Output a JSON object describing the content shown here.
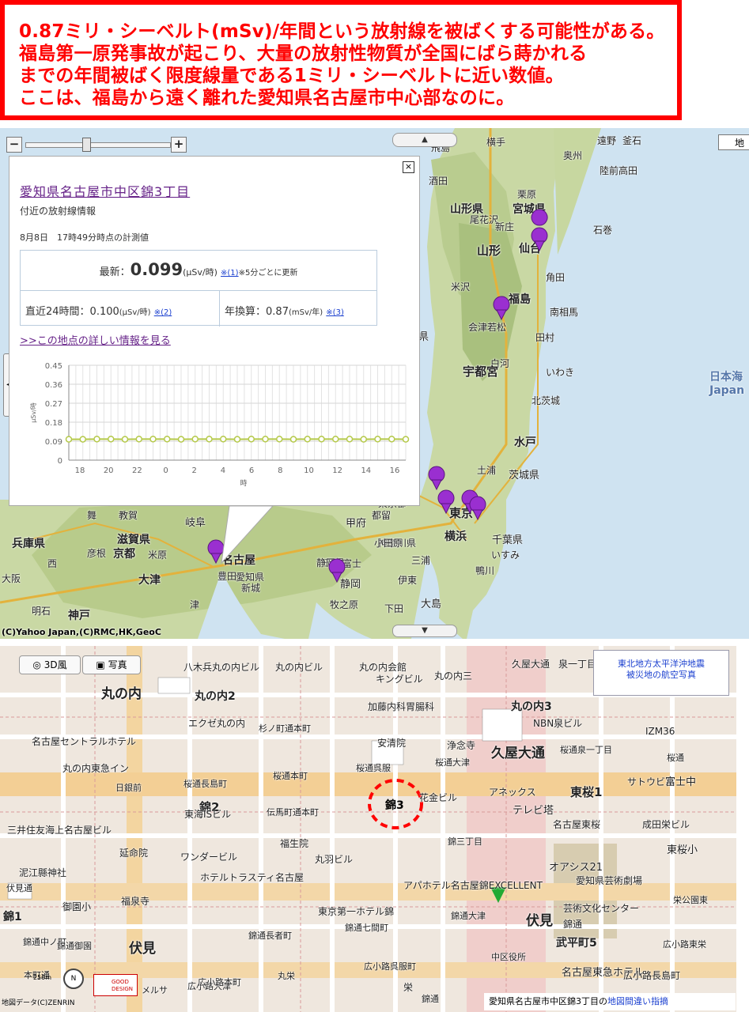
{
  "banner": {
    "lines": [
      "0.87ミリ・シーベルト(mSv)/年間という放射線を被ばくする可能性がある。",
      "福島第一原発事故が起こり、大量の放射性物質が全国にばら蒔かれる",
      "までの年間被ばく限度線量である1ミリ・シーベルトに近い数値。",
      "ここは、福島から遠く離れた愛知県名古屋市中心部なのに。"
    ],
    "color": "#ff0000"
  },
  "map_top": {
    "zoom_minus": "−",
    "zoom_plus": "+",
    "map_type": "地",
    "copyright": "(C)Yahoo Japan,(C)RMC,HK,GeoC",
    "labels": [
      "飛島",
      "横手",
      "遠野",
      "釜石",
      "酒田",
      "奥州",
      "陸前高田",
      "栗原",
      "山形県",
      "宮城県",
      "尾花沢",
      "仙台",
      "石巻",
      "山形",
      "新庄",
      "米沢",
      "角田",
      "福島",
      "南相馬",
      "福島県",
      "会津若松",
      "田村",
      "白河",
      "いわき",
      "北茨城",
      "宇都宮",
      "水戸",
      "土浦",
      "茨城県",
      "東京",
      "横浜",
      "千葉県",
      "いすみ",
      "鴨川",
      "三浦",
      "伊東",
      "下田",
      "大島",
      "甲府",
      "富士",
      "静岡",
      "牧之原",
      "名古屋",
      "岐阜",
      "京都",
      "大津",
      "津",
      "神戸",
      "明石",
      "滋賀県",
      "兵庫県",
      "米原",
      "新城",
      "愛知県",
      "教賀",
      "日本海",
      "Japan",
      "東京都",
      "神奈川県",
      "小田原",
      "三島",
      "都留",
      "静岡県",
      "彦根",
      "豊田",
      "西",
      "舞",
      "大阪"
    ]
  },
  "popup": {
    "close": "×",
    "title": "愛知県名古屋市中区錦3丁目",
    "subtitle": "付近の放射線情報",
    "time": "8月8日　17時49分時点の計測値",
    "latest_label": "最新：",
    "latest_value": "0.099",
    "latest_unit": "(μSv/時)",
    "latest_note": "※(1)",
    "latest_note2": "※5分ごとに更新",
    "avg_label": "直近24時間：",
    "avg_value": "0.100",
    "avg_unit": "(μSv/時)",
    "avg_note": "※(2)",
    "annual_label": "年換算：",
    "annual_value": "0.87",
    "annual_unit": "(mSv/年)",
    "annual_note": "※(3)",
    "link": ">>この地点の詳しい情報を見る"
  },
  "chart_data": {
    "type": "line",
    "title": "",
    "xlabel": "時",
    "ylabel": "μSv/時",
    "x_tick_labels": [
      "18",
      "20",
      "22",
      "0",
      "2",
      "4",
      "6",
      "8",
      "10",
      "12",
      "14",
      "16"
    ],
    "y_tick_labels": [
      "0.45",
      "0.36",
      "0.27",
      "0.18",
      "0.09",
      "0"
    ],
    "ylim": [
      0,
      0.45
    ],
    "grid": true,
    "series": [
      {
        "values": [
          0.099,
          0.099,
          0.1,
          0.1,
          0.099,
          0.1,
          0.1,
          0.1,
          0.099,
          0.1,
          0.1,
          0.1,
          0.099,
          0.1,
          0.1,
          0.1,
          0.099,
          0.1,
          0.1,
          0.1,
          0.1,
          0.099,
          0.1,
          0.1,
          0.099
        ]
      }
    ],
    "line_color": "#b5c94a"
  },
  "map_bottom": {
    "btn_3d": "3D風",
    "btn_photo": "写真",
    "aerial_link": "東北地方太平洋沖地震\n被災地の航空写真",
    "aerial_line1": "東北地方太平洋沖地震",
    "aerial_line2": "被災地の航空写真",
    "status_text": "愛知県名古屋市中区錦3丁目の",
    "status_link": "地図間違い指摘",
    "copyright": "地図データ(C)ZENRIN",
    "scale": "250m",
    "good_design": "GOOD DESIGN",
    "compass": "N",
    "highlight": "錦3",
    "labels": [
      "丸の内",
      "丸の内2",
      "丸の内3",
      "丸の内ビル",
      "丸の内会館",
      "八木兵丸の内ビル",
      "キングビル",
      "丸の内三",
      "久屋大通",
      "泉一丁目",
      "名古屋セントラルホテル",
      "エクゼ丸の内",
      "杉ノ町通本町",
      "加藤内科胃腸科",
      "NBN泉ビル",
      "IZM36",
      "安清院",
      "浄念寺",
      "久屋大通",
      "桜通泉一丁目",
      "丸の内東急イン",
      "桜通呉服",
      "桜通大津",
      "桜通",
      "日銀前",
      "桜通長島町",
      "桜通本町",
      "花金ビル",
      "アネックス",
      "テレビ塔",
      "東桜1",
      "サトウビル",
      "富士中",
      "錦2",
      "伝馬町通本町",
      "錦三丁目",
      "名古屋東桜",
      "成田栄ビル",
      "東桜小",
      "三井住友海上名古屋ビル",
      "東海ISビル",
      "福生院",
      "丸羽ビル",
      "延命院",
      "ワンダービル",
      "オアシス21",
      "愛知県芸術劇場",
      "伏見通",
      "泥江縣神社",
      "ホテルトラスティ名古屋",
      "アパホテル名古屋錦EXCELLENT",
      "御園小",
      "福泉寺",
      "芸術文化センター",
      "栄公園東",
      "錦1",
      "東京第一ホテル錦",
      "錦通大津",
      "錦通",
      "錦通中ノ町",
      "錦通御園",
      "錦通長者町",
      "錦通七間町",
      "武平町5",
      "広小路東栄",
      "伏見",
      "広小路呉服町",
      "広小路大津",
      "中区役所",
      "名古屋東急ホテル",
      "広小路長島町",
      "広小路本町",
      "丸栄",
      "栄",
      "伏見",
      "メルサ",
      "錦通",
      "本町通"
    ]
  }
}
